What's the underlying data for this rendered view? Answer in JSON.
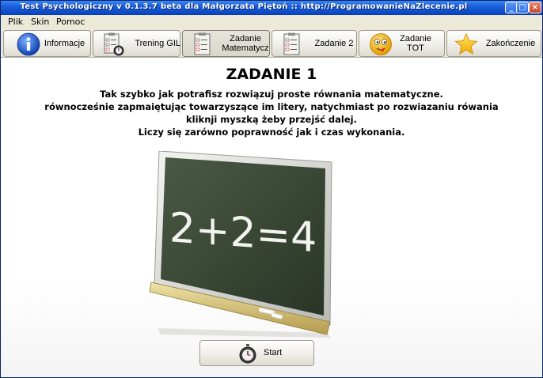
{
  "window": {
    "title": "Test Psychologiczny v 0.1.3.7 beta dla Małgorzata Piętoń :: http://ProgramowanieNaZlecenie.pl"
  },
  "menu": {
    "items": [
      "Plik",
      "Skin",
      "Pomoc"
    ]
  },
  "tabs": [
    {
      "label": "Informacje",
      "icon": "info-icon"
    },
    {
      "label": "Trening GIL",
      "icon": "checklist-stopwatch-icon"
    },
    {
      "label": "Zadanie\nMatematycz",
      "icon": "checklist-icon"
    },
    {
      "label": "Zadanie 2",
      "icon": "checklist-icon"
    },
    {
      "label": "Zadanie\nTOT",
      "icon": "smiley-face-icon"
    },
    {
      "label": "Zakończenie",
      "icon": "star-icon"
    }
  ],
  "main": {
    "heading": "ZADANIE 1",
    "description": [
      "Tak szybko jak potrafisz rozwiązuj proste równania matematyczne.",
      "równocześnie zapmaiętując towarzyszące im litery, natychmiast po rozwiazaniu rówania",
      "kliknji myszką żeby przejść dalej.",
      "Liczy się zarówno poprawność jak i czas wykonania."
    ],
    "chalkboard_text": "2+2=4",
    "start_label": "Start"
  },
  "colors": {
    "titlebar": "#0b46c2",
    "board": "#3a4a34",
    "frame": "#d8d8d4"
  }
}
